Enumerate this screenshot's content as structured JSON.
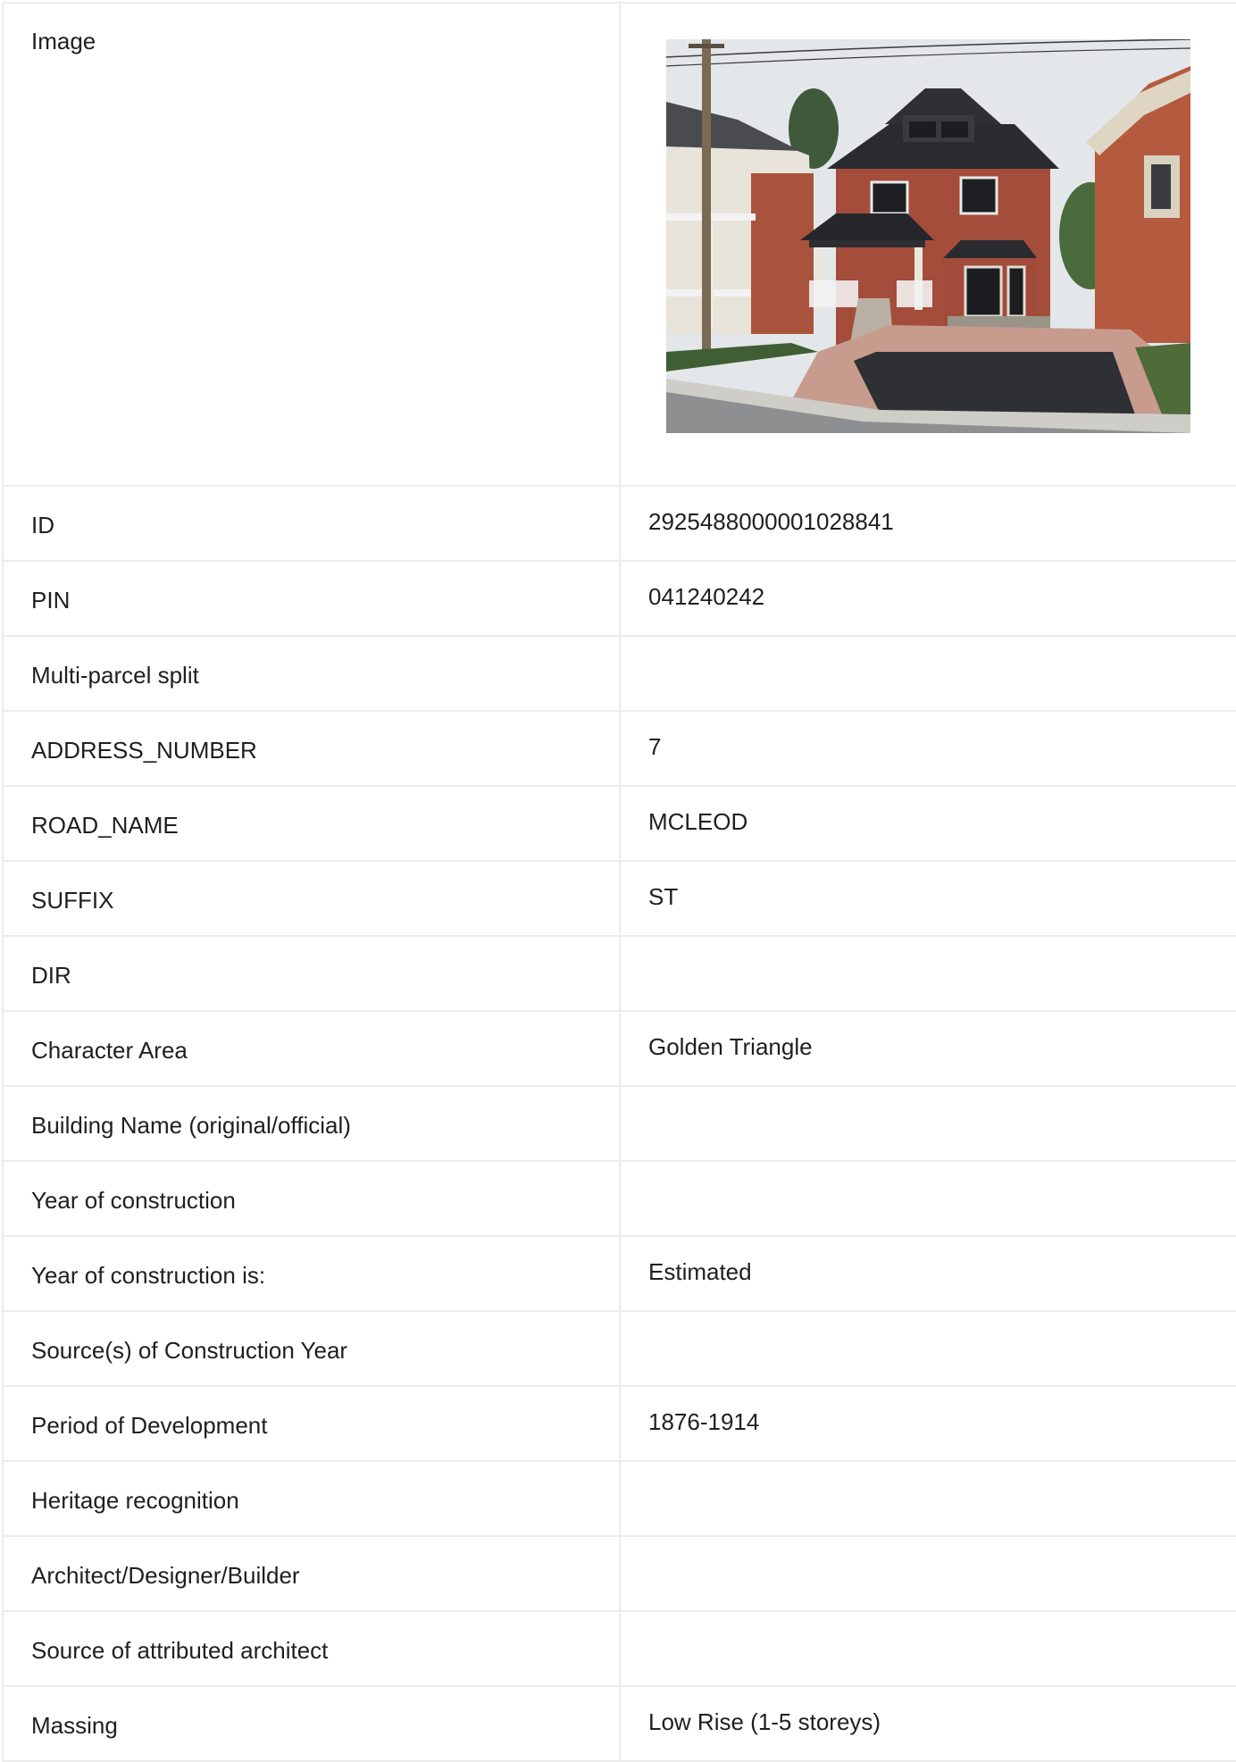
{
  "rows": [
    {
      "label": "Image",
      "value": ""
    },
    {
      "label": "ID",
      "value": "2925488000001028841"
    },
    {
      "label": "PIN",
      "value": "041240242"
    },
    {
      "label": "Multi-parcel split",
      "value": ""
    },
    {
      "label": "ADDRESS_NUMBER",
      "value": "7"
    },
    {
      "label": "ROAD_NAME",
      "value": "MCLEOD"
    },
    {
      "label": "SUFFIX",
      "value": "ST"
    },
    {
      "label": "DIR",
      "value": ""
    },
    {
      "label": "Character Area",
      "value": "Golden Triangle"
    },
    {
      "label": "Building Name (original/official)",
      "value": ""
    },
    {
      "label": "Year of construction",
      "value": ""
    },
    {
      "label": "Year of construction is:",
      "value": "Estimated"
    },
    {
      "label": "Source(s) of Construction Year",
      "value": ""
    },
    {
      "label": "Period of Development",
      "value": "1876-1914"
    },
    {
      "label": "Heritage recognition",
      "value": ""
    },
    {
      "label": "Architect/Designer/Builder",
      "value": ""
    },
    {
      "label": "Source of attributed architect",
      "value": ""
    },
    {
      "label": "Massing",
      "value": "Low Rise (1-5 storeys)"
    }
  ]
}
